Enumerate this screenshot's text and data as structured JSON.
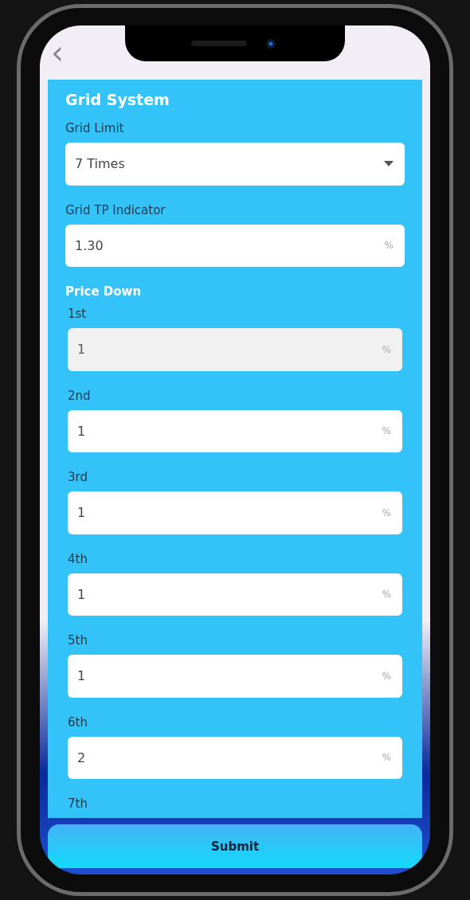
{
  "header": {
    "back": "‹"
  },
  "section": {
    "title": "Grid System"
  },
  "grid_limit": {
    "label": "Grid Limit",
    "value": "7 Times"
  },
  "grid_tp": {
    "label": "Grid TP Indicator",
    "value": "1.30",
    "suffix": "%"
  },
  "price_down": {
    "title": "Price Down",
    "fields": [
      {
        "label": "1st",
        "value": "1",
        "suffix": "%",
        "disabled": true
      },
      {
        "label": "2nd",
        "value": "1",
        "suffix": "%",
        "disabled": false
      },
      {
        "label": "3rd",
        "value": "1",
        "suffix": "%",
        "disabled": false
      },
      {
        "label": "4th",
        "value": "1",
        "suffix": "%",
        "disabled": false
      },
      {
        "label": "5th",
        "value": "1",
        "suffix": "%",
        "disabled": false
      },
      {
        "label": "6th",
        "value": "2",
        "suffix": "%",
        "disabled": false
      },
      {
        "label": "7th"
      }
    ]
  },
  "submit": "Submit"
}
